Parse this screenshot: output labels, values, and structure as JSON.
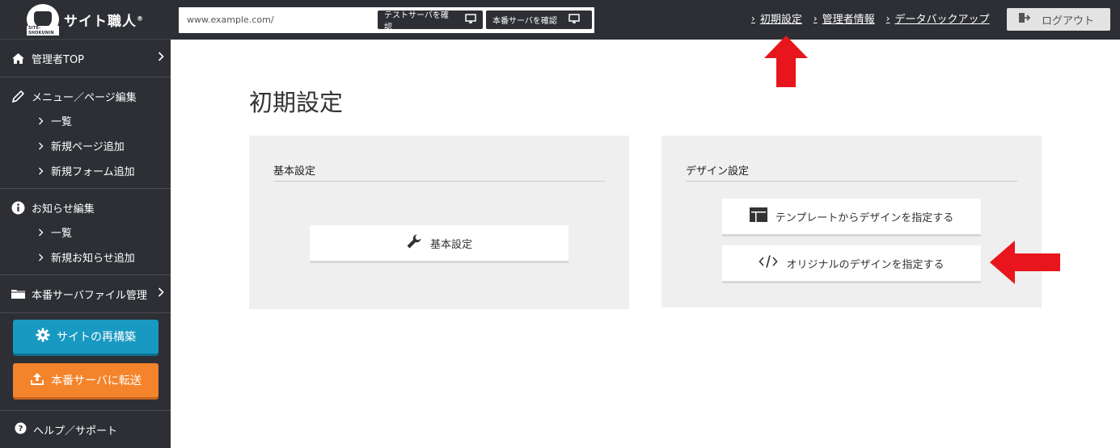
{
  "logo": {
    "text": "サイト職人",
    "tag": "SITE-SHOKUNIN"
  },
  "sidebar": {
    "sections": [
      {
        "label": "管理者TOP",
        "items": []
      },
      {
        "label": "メニュー／ページ編集",
        "items": [
          "一覧",
          "新規ページ追加",
          "新規フォーム追加"
        ]
      },
      {
        "label": "お知らせ編集",
        "items": [
          "一覧",
          "新規お知らせ追加"
        ]
      },
      {
        "label": "本番サーバファイル管理",
        "items": []
      }
    ],
    "rebuild_label": "サイトの再構築",
    "transfer_label": "本番サーバに転送",
    "help_label": "ヘルプ／サポート"
  },
  "topbar": {
    "url": "www.example.com/",
    "test_server_label": "テストサーバを確認",
    "prod_server_label": "本番サーバを確認",
    "links": [
      "初期設定",
      "管理者情報",
      "データバックアップ"
    ],
    "logout_label": "ログアウト"
  },
  "main": {
    "title": "初期設定",
    "basic_panel": {
      "title": "基本設定",
      "button": "基本設定"
    },
    "design_panel": {
      "title": "デザイン設定",
      "template_button": "テンプレートからデザインを指定する",
      "original_button": "オリジナルのデザインを指定する"
    }
  },
  "colors": {
    "sidebar_bg": "#2d2f35",
    "rebuild_btn": "#1899c2",
    "transfer_btn": "#f4842b",
    "panel_bg": "#efefef",
    "annotation_arrow": "#e8161c"
  }
}
